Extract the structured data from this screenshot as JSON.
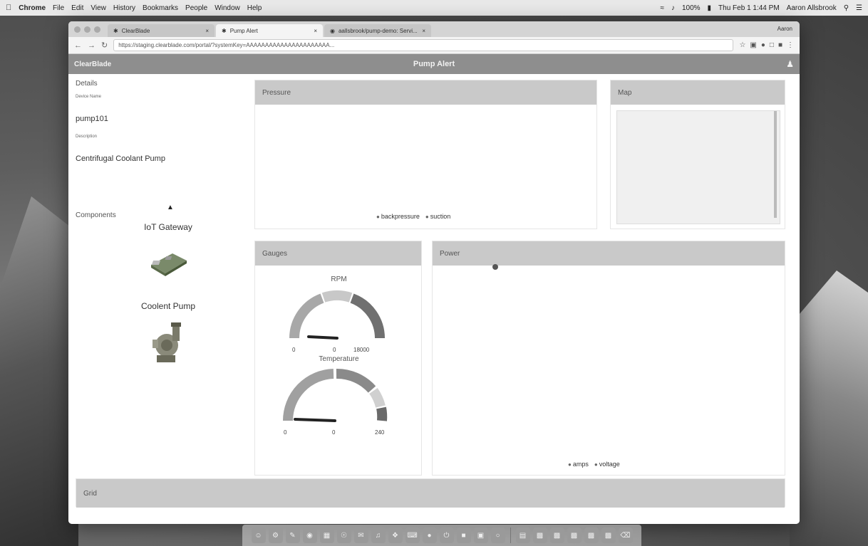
{
  "menubar": {
    "app_name": "Chrome",
    "items": [
      "File",
      "Edit",
      "View",
      "History",
      "Bookmarks",
      "People",
      "Window",
      "Help"
    ],
    "battery": "100%",
    "datetime": "Thu Feb 1 1:44 PM",
    "user": "Aaron Allsbrook"
  },
  "browser": {
    "tabs": [
      {
        "title": "ClearBlade",
        "active": false
      },
      {
        "title": "Pump Alert",
        "active": true
      },
      {
        "title": "aallsbrook/pump-demo: Servi...",
        "active": false
      }
    ],
    "profile": "Aaron",
    "url": "https://staging.clearblade.com/portal/?systemKey=AAAAAAAAAAAAAAAAAAAAAA..."
  },
  "app": {
    "logo": "ClearBlade",
    "title": "Pump Alert"
  },
  "details": {
    "title": "Details",
    "device_name_label": "Device Name",
    "device_name": "pump101",
    "description_label": "Description",
    "description": "Centrifugal Coolant Pump",
    "components_title": "Components",
    "components": [
      {
        "name": "IoT Gateway"
      },
      {
        "name": "Coolent Pump"
      }
    ]
  },
  "panels": {
    "pressure": "Pressure",
    "map": "Map",
    "gauges": "Gauges",
    "power": "Power",
    "grid": "Grid"
  },
  "pressure_legend": [
    "backpressure",
    "suction"
  ],
  "power_legend": [
    "amps",
    "voltage"
  ],
  "gauges": [
    {
      "title": "RPM",
      "min": "0",
      "value": "0",
      "max": "18000",
      "value_fraction": 0
    },
    {
      "title": "Temperature",
      "min": "0",
      "value": "0",
      "max": "240",
      "value_fraction": 0
    }
  ],
  "colors": {
    "header": "#8e8e8e",
    "panel_header": "#c9c9c9"
  }
}
